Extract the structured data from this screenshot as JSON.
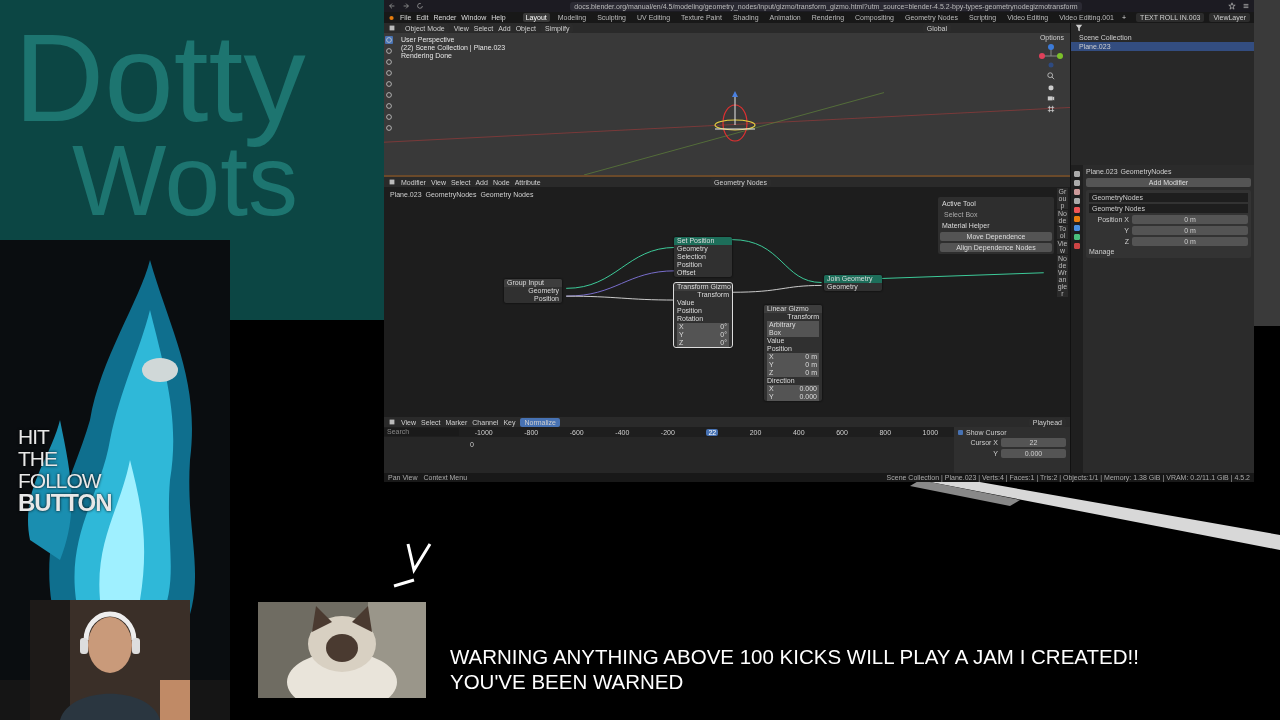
{
  "banner": {
    "lines": [
      "Dotty",
      "Wots"
    ]
  },
  "browser": {
    "url": "docs.blender.org/manual/en/4.5/modeling/geometry_nodes/input/gizmo/transform_gizmo.html?utm_source=blender-4.5.2-bpy-types-geometrynodegizmotransform"
  },
  "topbar": {
    "menus": [
      "File",
      "Edit",
      "Render",
      "Window",
      "Help"
    ],
    "workspaces": [
      {
        "label": "Layout",
        "selected": true
      },
      {
        "label": "Modeling",
        "selected": false
      },
      {
        "label": "Sculpting",
        "selected": false
      },
      {
        "label": "UV Editing",
        "selected": false
      },
      {
        "label": "Texture Paint",
        "selected": false
      },
      {
        "label": "Shading",
        "selected": false
      },
      {
        "label": "Animation",
        "selected": false
      },
      {
        "label": "Rendering",
        "selected": false
      },
      {
        "label": "Compositing",
        "selected": false
      },
      {
        "label": "Geometry Nodes",
        "selected": false
      },
      {
        "label": "Scripting",
        "selected": false
      },
      {
        "label": "Video Editing",
        "selected": false
      },
      {
        "label": "Video Editing.001",
        "selected": false
      }
    ],
    "add": "+",
    "scene": "TEXT ROLL IN.003",
    "view_layer": "ViewLayer"
  },
  "viewport": {
    "mode": "Object Mode",
    "menus": [
      "View",
      "Select",
      "Add",
      "Object"
    ],
    "simplify": "Simplify",
    "orientation": "Global",
    "options": "Options",
    "overlay": [
      "User Perspective",
      "(22) Scene Collection | Plane.023",
      "Rendering Done"
    ]
  },
  "outliner": {
    "items": [
      {
        "label": "Scene Collection",
        "selected": false
      },
      {
        "label": "Plane.023",
        "selected": true
      }
    ]
  },
  "node_editor": {
    "menus": [
      "Modifier",
      "View",
      "Select",
      "Add",
      "Node",
      "Attribute"
    ],
    "tree": "Geometry Nodes",
    "breadcrumbs": [
      "Plane.023",
      "GeometryNodes",
      "Geometry Nodes"
    ],
    "nodes": [
      {
        "title": "Group Input",
        "kind": "utility",
        "rows": [
          {
            "label": "Geometry",
            "kind": "output"
          },
          {
            "label": "Position",
            "kind": "output"
          }
        ]
      },
      {
        "title": "Set Position",
        "kind": "geometry",
        "rows": [
          {
            "label": "Geometry",
            "kind": "input"
          },
          {
            "label": "Selection",
            "kind": "input"
          },
          {
            "label": "Position",
            "kind": "input"
          },
          {
            "label": "Offset",
            "kind": "input"
          }
        ]
      },
      {
        "title": "Join Geometry",
        "kind": "geometry",
        "rows": [
          {
            "label": "Geometry",
            "kind": "input"
          }
        ]
      },
      {
        "title": "Transform Gizmo",
        "kind": "utility",
        "rows": [
          {
            "label": "Transform",
            "kind": "output"
          },
          {
            "label": "Value",
            "kind": "input"
          },
          {
            "label": "Position",
            "kind": "input"
          },
          {
            "label": "Rotation",
            "kind": "input"
          },
          {
            "label": "X",
            "value": "0°",
            "kind": "field"
          },
          {
            "label": "Y",
            "value": "0°",
            "kind": "field"
          },
          {
            "label": "Z",
            "value": "0°",
            "kind": "field"
          }
        ]
      },
      {
        "title": "Linear Gizmo",
        "kind": "utility",
        "rows": [
          {
            "label": "Transform",
            "kind": "output"
          },
          {
            "label": "Arbitrary",
            "kind": "select"
          },
          {
            "label": "Box",
            "kind": "select"
          },
          {
            "label": "Value",
            "kind": "input"
          },
          {
            "label": "Position",
            "kind": "input"
          },
          {
            "label": "X",
            "value": "0 m",
            "kind": "field"
          },
          {
            "label": "Y",
            "value": "0 m",
            "kind": "field"
          },
          {
            "label": "Z",
            "value": "0 m",
            "kind": "field"
          },
          {
            "label": "Direction",
            "kind": "input"
          },
          {
            "label": "X",
            "value": "0.000",
            "kind": "field"
          },
          {
            "label": "Y",
            "value": "0.000",
            "kind": "field"
          }
        ]
      }
    ],
    "panel": [
      {
        "title": "Active Tool",
        "tool": "Select Box"
      },
      {
        "title": "Material Helper",
        "buttons": [
          "Move Dependence",
          "Align Dependence Nodes"
        ]
      }
    ],
    "tabs": [
      "Group",
      "Node",
      "Tool",
      "View",
      "Node Wrangler"
    ]
  },
  "graph_editor": {
    "menus": [
      "View",
      "Select",
      "Marker",
      "Channel",
      "Key"
    ],
    "normalize": "Normalize",
    "search": "Search",
    "ticks": [
      "-1000",
      "-800",
      "-600",
      "-400",
      "-200",
      "22",
      "200",
      "400",
      "600",
      "800",
      "1000"
    ],
    "channel_value": "0",
    "playhead": "Playhead",
    "show_cursor": {
      "label": "Show Cursor",
      "checked": true
    },
    "fields": [
      {
        "label": "Cursor X",
        "value": "22"
      },
      {
        "label": "Y",
        "value": "0.000"
      }
    ]
  },
  "properties": {
    "breadcrumbs": [
      "Plane.023",
      "GeometryNodes"
    ],
    "add_modifier": "Add Modifier",
    "modifier": "GeometryNodes",
    "node_group": "Geometry Nodes",
    "fields": [
      {
        "label": "Position X",
        "value": "0 m"
      },
      {
        "label": "Y",
        "value": "0 m"
      },
      {
        "label": "Z",
        "value": "0 m"
      }
    ],
    "manage": "Manage"
  },
  "status_bar": {
    "hints": [
      "Pan View",
      "Context Menu"
    ],
    "stats": "Scene Collection | Plane.023 | Verts:4 | Faces:1 | Tris:2 | Objects:1/1 | Memory: 1.38 GiB | VRAM: 0.2/11.1 GiB | 4.5.2"
  },
  "follow": [
    "HIT",
    "THE",
    "FOLLOW",
    "BUTTON"
  ],
  "warning": [
    "WARNING ANYTHING ABOVE 100 KICKS WILL PLAY A JAM I CREATED!!",
    "YOU'VE BEEN WARNED"
  ]
}
